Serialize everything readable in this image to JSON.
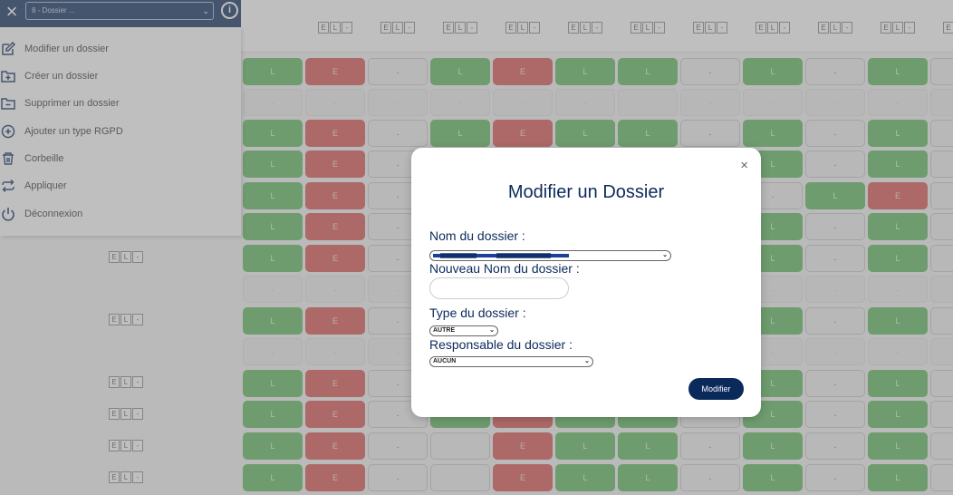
{
  "header": {
    "close_glyph": "×",
    "folder_select_value": "8 - Dossier ...",
    "info_glyph": "i"
  },
  "columns": {
    "el_buttons": [
      "E",
      "L",
      "-"
    ]
  },
  "menu": [
    {
      "label": "Modifier un dossier",
      "icon": "edit-icon"
    },
    {
      "label": "Créer un dossier",
      "icon": "folder-plus-icon"
    },
    {
      "label": "Supprimer un dossier",
      "icon": "folder-minus-icon"
    },
    {
      "label": "Ajouter un type RGPD",
      "icon": "plus-circle-icon"
    },
    {
      "label": "Corbeille",
      "icon": "trash-icon"
    },
    {
      "label": "Appliquer",
      "icon": "repeat-icon"
    },
    {
      "label": "Déconnexion",
      "icon": "power-icon"
    }
  ],
  "grid": {
    "cell_labels": {
      "L": "L",
      "E": "E",
      "dash": "-"
    }
  },
  "modal": {
    "close_glyph": "×",
    "title": "Modifier un Dossier",
    "folder_name_label": "Nom du dossier :",
    "new_name_label": "Nouveau Nom du dossier :",
    "new_name_value": "",
    "type_label": "Type du dossier :",
    "type_value": "AUTRE",
    "owner_label": "Responsable du dossier :",
    "owner_value": "AUCUN",
    "submit_label": "Modifier"
  },
  "colors": {
    "navy": "#0b2a5c",
    "green": "#5cb85c",
    "red": "#d9534f",
    "overlay": "rgba(128,128,128,0.5)"
  }
}
